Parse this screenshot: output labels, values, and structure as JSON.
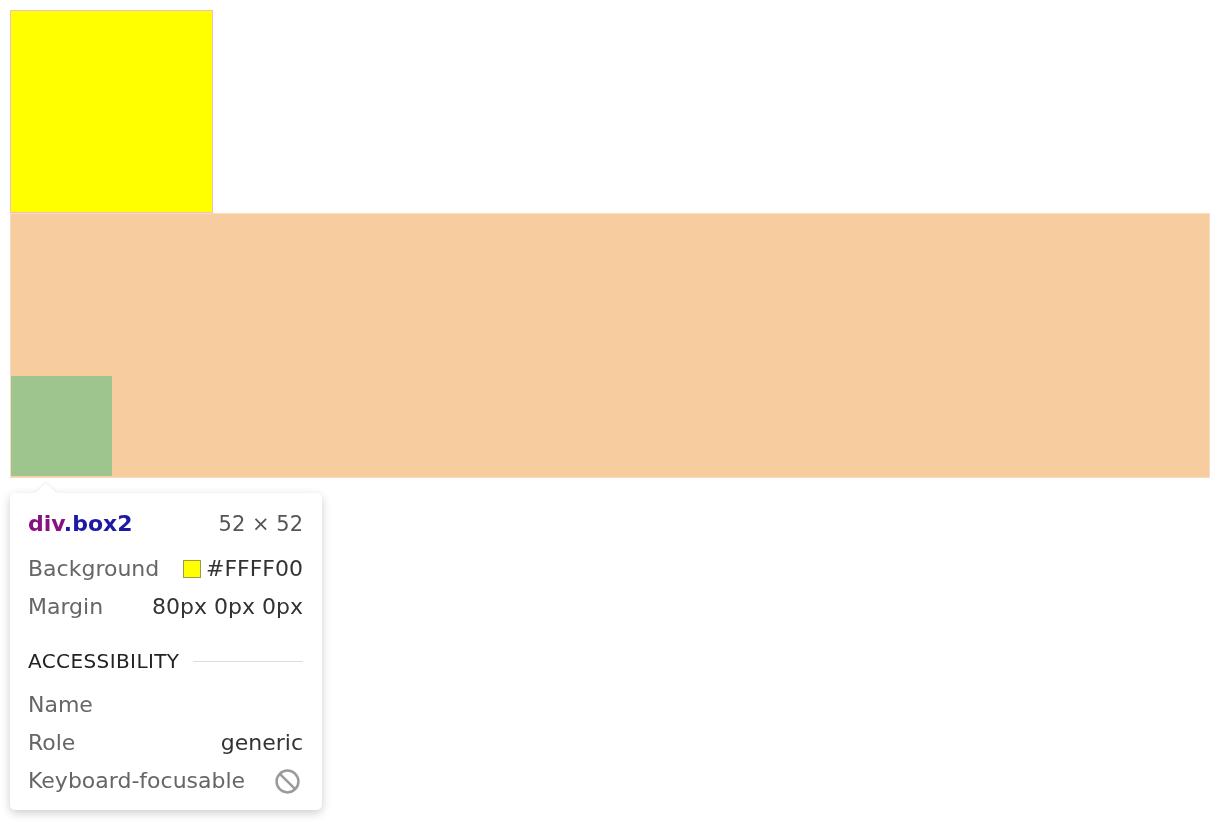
{
  "inspector_tooltip": {
    "selector": {
      "tag": "div",
      "class_name": ".box2"
    },
    "size": "52 × 52",
    "properties": [
      {
        "label": "Background",
        "value": "#FFFF00",
        "color": "#ffff00"
      },
      {
        "label": "Margin",
        "value": "80px 0px 0px"
      }
    ],
    "accessibility": {
      "heading": "ACCESSIBILITY",
      "rows": [
        {
          "kind": "text",
          "label": "Name"
        },
        {
          "kind": "text",
          "label": "Role",
          "value": "generic"
        },
        {
          "kind": "flag",
          "label": "Keyboard-focusable",
          "on": false
        }
      ]
    }
  }
}
